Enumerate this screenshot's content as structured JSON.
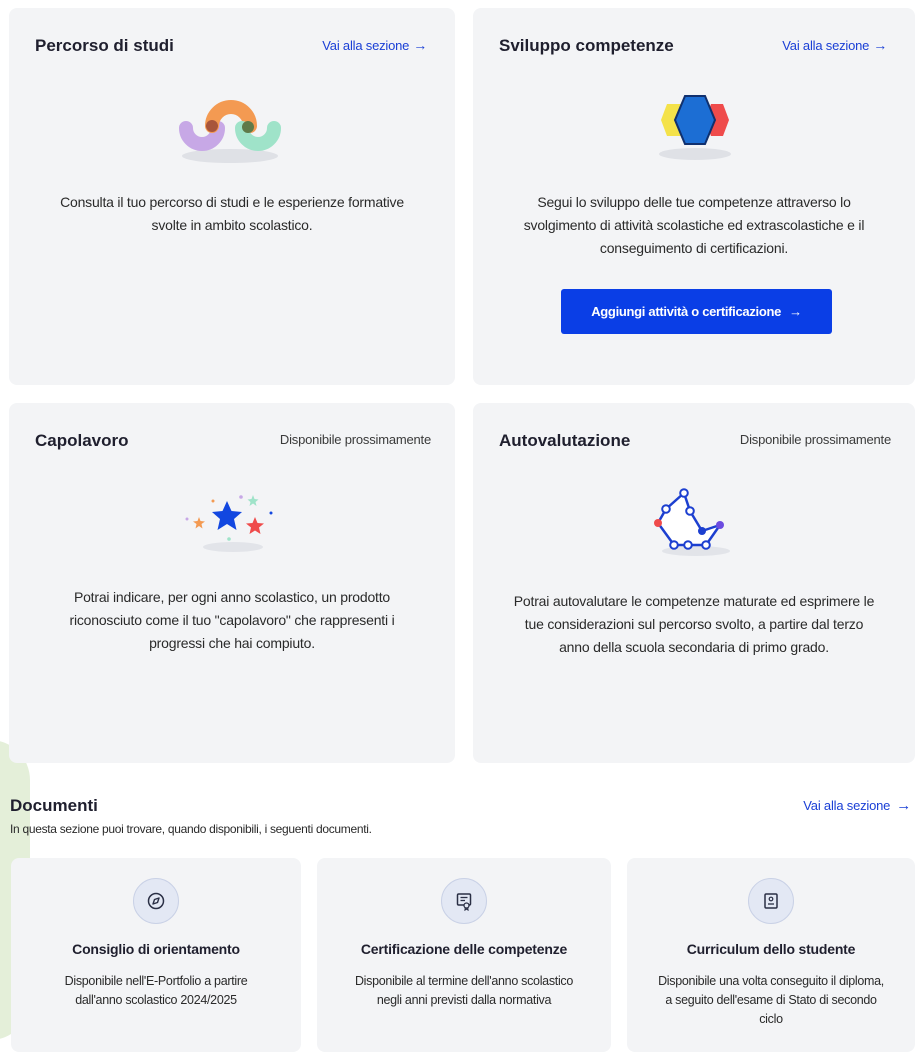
{
  "cards": [
    {
      "title": "Percorso di studi",
      "link": "Vai alla sezione",
      "description": "Consulta il tuo percorso di studi e le esperienze formative svolte in ambito scolastico."
    },
    {
      "title": "Sviluppo competenze",
      "link": "Vai alla sezione",
      "description": "Segui lo sviluppo delle tue competenze attraverso lo svolgimento di attività scolastiche ed extrascolastiche e il conseguimento di certificazioni.",
      "cta": "Aggiungi attività o certificazione"
    },
    {
      "title": "Capolavoro",
      "status": "Disponibile prossimamente",
      "description": "Potrai indicare, per ogni anno scolastico, un prodotto riconosciuto come il tuo \"capolavoro\" che rappresenti i progressi che hai compiuto."
    },
    {
      "title": "Autovalutazione",
      "status": "Disponibile prossimamente",
      "description": "Potrai autovalutare le competenze maturate ed esprimere le tue considerazioni sul percorso svolto, a partire dal terzo anno della scuola secondaria di primo grado."
    }
  ],
  "documents": {
    "title": "Documenti",
    "subtitle": "In questa sezione puoi trovare, quando disponibili, i seguenti documenti.",
    "link": "Vai alla sezione",
    "items": [
      {
        "icon": "compass-icon",
        "title": "Consiglio di orientamento",
        "description": "Disponibile nell'E-Portfolio a partire dall'anno scolastico 2024/2025"
      },
      {
        "icon": "certificate-icon",
        "title": "Certificazione delle competenze",
        "description": "Disponibile al termine dell'anno scolastico negli anni previsti dalla normativa"
      },
      {
        "icon": "document-icon",
        "title": "Curriculum dello studente",
        "description": "Disponibile una volta conseguito il diploma, a seguito dell'esame di Stato di secondo ciclo"
      }
    ]
  },
  "colors": {
    "accent": "#0a3ee6",
    "link": "#1a3fd6",
    "card_bg": "#f3f4f6",
    "deco_green": "#e4efd9"
  }
}
